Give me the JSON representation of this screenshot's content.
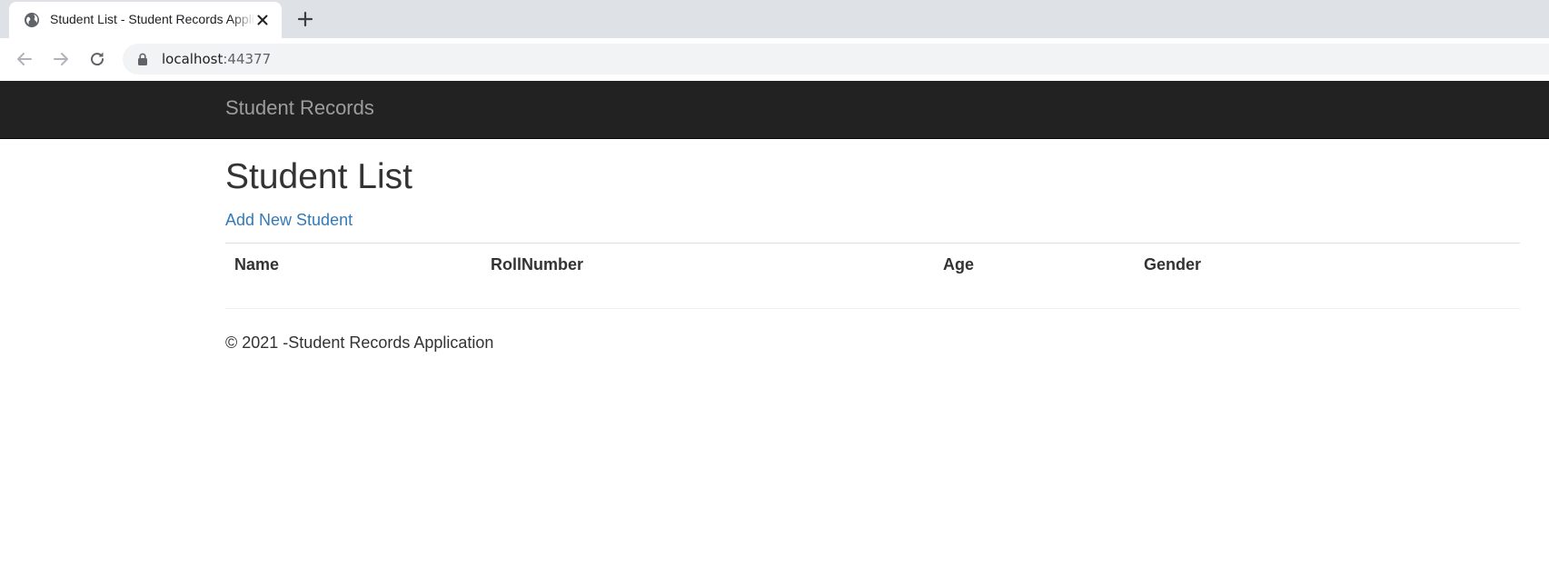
{
  "browser": {
    "tab_title": "Student List - Student Records Application",
    "url_host": "localhost",
    "url_port": ":44377",
    "icons": {
      "favicon": "globe-icon",
      "tab_close": "close-icon",
      "new_tab": "plus-icon",
      "back": "arrow-left-icon",
      "forward": "arrow-right-icon",
      "reload": "reload-icon",
      "lock": "lock-icon"
    }
  },
  "navbar": {
    "brand": "Student Records"
  },
  "main": {
    "title": "Student List",
    "add_link": "Add New Student",
    "table": {
      "columns": [
        "Name",
        "RollNumber",
        "Age",
        "Gender"
      ],
      "rows": []
    }
  },
  "footer": {
    "text": "© 2021 -Student Records Application"
  },
  "colors": {
    "navbar_bg": "#222222",
    "brand_text": "#9d9d9d",
    "link": "#337ab7",
    "text": "#333333",
    "tabstrip_bg": "#dee1e6",
    "omnibox_bg": "#f1f3f4"
  }
}
